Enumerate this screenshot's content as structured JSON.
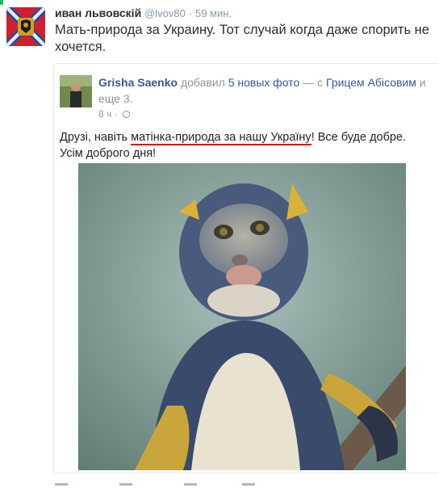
{
  "tweet": {
    "author_name": "иван львовскій",
    "author_handle": "@lvov80",
    "separator": "·",
    "time": "59 мин.",
    "text": "Мать-природа за Украину. Тот случай когда даже спорить не хочется."
  },
  "fb_post": {
    "author": "Grisha Saenko",
    "action": "добавил",
    "photos_link": "5 новых фото",
    "with_sep": "— с",
    "tagged": "Грицем Абісовим",
    "and_more": "и еще 3.",
    "time": "8 ч",
    "text_before": "Друзі, навіть ",
    "text_highlight": "матінка-природа за нашу Україну",
    "text_after": "! Все буде добре. Усім доброго дня!"
  },
  "colors": {
    "fb_blue": "#365899",
    "underline_red": "#d0191a",
    "twitter_gray": "#8899a6",
    "flag_blue": "#1f4ea3",
    "flag_red": "#d01f2f"
  },
  "icons": [
    "reply-icon",
    "retweet-icon",
    "like-icon",
    "more-icon",
    "globe-icon"
  ]
}
